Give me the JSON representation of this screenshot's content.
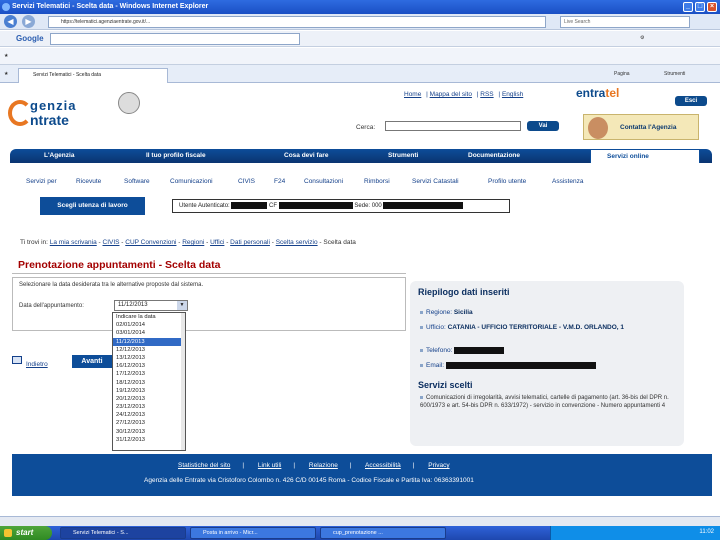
{
  "window": {
    "title": "Servizi Telematici - Scelta data - Windows Internet Explorer"
  },
  "browser": {
    "url": "https://telematici.agenziaentrate.gov.it/...",
    "search_placeholder": "Live Search",
    "google_label": "Google",
    "tab_label": "Servizi Telematici - Scelta data",
    "commands": [
      "Pagina",
      "Strumenti"
    ]
  },
  "header": {
    "logo_line1": "genzia",
    "logo_line2": "ntrate",
    "toplinks": [
      "Home",
      "Mappa del sito",
      "RSS",
      "English"
    ],
    "entratel_a": "entra",
    "entratel_b": "tel",
    "esci": "Esci",
    "cerca_label": "Cerca:",
    "vai": "Vai",
    "contatta": "Contatta l'Agenzia"
  },
  "mainmenu": [
    "L'Agenzia",
    "Il tuo profilo fiscale",
    "Cosa devi fare",
    "Strumenti",
    "Documentazione"
  ],
  "mainmenu_active": "Servizi online",
  "submenu": [
    "Servizi per",
    "Ricevute",
    "Software",
    "Comunicazioni",
    "CIVIS",
    "F24",
    "Consultazioni",
    "Rimborsi",
    "Servizi Catastali",
    "Profilo utente",
    "Assistenza"
  ],
  "userbar": {
    "button": "Scegli utenza di lavoro",
    "utente_label": "Utente Autenticato:",
    "cf_label": "CF",
    "sede_label": "Sede: 000"
  },
  "breadcrumb": {
    "lead": "Ti trovi in:",
    "items": [
      "La mia scrivania",
      "CIVIS",
      "CUP Convenzioni",
      "Regioni",
      "Uffici",
      "Dati personali",
      "Scelta servizio"
    ],
    "current": "Scelta data"
  },
  "page_title": "Prenotazione appuntamenti - Scelta data",
  "form": {
    "instructions": "Selezionare la data desiderata tra le alternative proposte dal sistema.",
    "date_label": "Data dell'appuntamento:",
    "date_value": "11/12/2013",
    "options": [
      "Indicare la data",
      "02/01/2014",
      "03/01/2014",
      "11/12/2013",
      "12/12/2013",
      "13/12/2013",
      "16/12/2013",
      "17/12/2013",
      "18/12/2013",
      "19/12/2013",
      "20/12/2013",
      "23/12/2013",
      "24/12/2013",
      "27/12/2013",
      "30/12/2013",
      "31/12/2013"
    ],
    "selected_index": 3,
    "indietro": "Indietro",
    "avanti": "Avanti"
  },
  "riepilogo": {
    "title": "Riepilogo dati inseriti",
    "regione_label": "Regione:",
    "regione": "Sicilia",
    "ufficio_label": "Ufficio:",
    "ufficio": "CATANIA - UFFICIO TERRITORIALE - V.M.D. ORLANDO, 1",
    "telefono_label": "Telefono:",
    "email_label": "Email:",
    "servizi_title": "Servizi scelti",
    "servizi_text": "Comunicazioni di irregolarità, avvisi telematici, cartelle di pagamento (art. 36-bis del DPR n. 600/1973 e art. 54-bis DPR n. 633/1972) - servizio in convenzione - Numero appuntamenti 4"
  },
  "footer": {
    "links": [
      "Statistiche del sito",
      "Link utili",
      "Relazione",
      "Accessibilità",
      "Privacy"
    ],
    "address": "Agenzia delle Entrate via Cristoforo Colombo n. 426 C/D 00145 Roma - Codice Fiscale e Partita Iva: 06363391001"
  },
  "taskbar": {
    "start": "start",
    "items": [
      "Servizi Telematici - S...",
      "Posta in arrivo - Micr...",
      "cup_prenotazione ..."
    ],
    "clock": "11:02"
  }
}
